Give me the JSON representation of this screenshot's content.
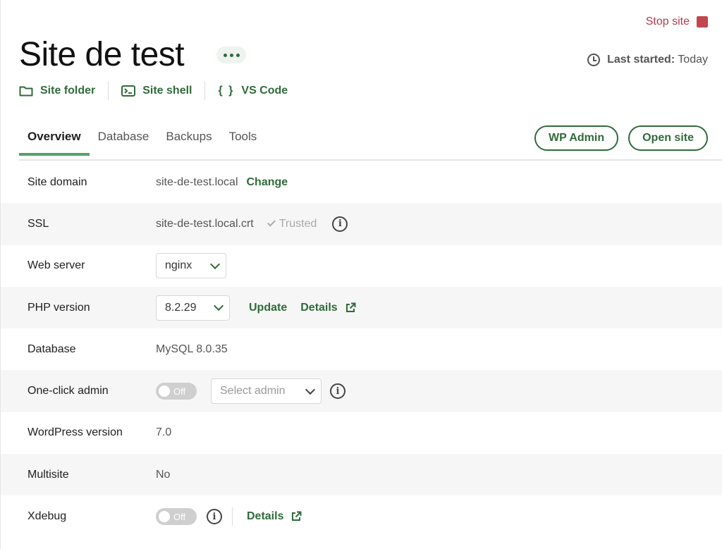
{
  "header": {
    "stop_site_label": "Stop site",
    "site_title": "Site de test",
    "last_started_label": "Last started:",
    "last_started_value": "Today",
    "quick_links": {
      "site_folder": "Site folder",
      "site_shell": "Site shell",
      "vs_code_icon": "{ }",
      "vs_code": "VS Code"
    }
  },
  "tabs": [
    {
      "label": "Overview",
      "active": true
    },
    {
      "label": "Database",
      "active": false
    },
    {
      "label": "Backups",
      "active": false
    },
    {
      "label": "Tools",
      "active": false
    }
  ],
  "buttons": {
    "wp_admin": "WP Admin",
    "open_site": "Open site"
  },
  "rows": {
    "site_domain": {
      "label": "Site domain",
      "value": "site-de-test.local",
      "action": "Change"
    },
    "ssl": {
      "label": "SSL",
      "value": "site-de-test.local.crt",
      "status": "Trusted"
    },
    "web_server": {
      "label": "Web server",
      "value": "nginx"
    },
    "php_version": {
      "label": "PHP version",
      "value": "8.2.29",
      "update": "Update",
      "details": "Details"
    },
    "database": {
      "label": "Database",
      "value": "MySQL 8.0.35"
    },
    "one_click_admin": {
      "label": "One-click admin",
      "toggle": "Off",
      "placeholder": "Select admin"
    },
    "wordpress_version": {
      "label": "WordPress version",
      "value": "7.0"
    },
    "multisite": {
      "label": "Multisite",
      "value": "No"
    },
    "xdebug": {
      "label": "Xdebug",
      "toggle": "Off",
      "details": "Details"
    }
  },
  "colors": {
    "accent_green": "#2f6b3a",
    "tab_indicator": "#4fa468",
    "stop_red": "#c0474f"
  },
  "icons": [
    "stop-icon",
    "more-icon",
    "clock-icon",
    "folder-icon",
    "terminal-icon",
    "code-braces-icon",
    "check-icon",
    "info-icon",
    "chevron-down-icon",
    "external-link-icon"
  ]
}
